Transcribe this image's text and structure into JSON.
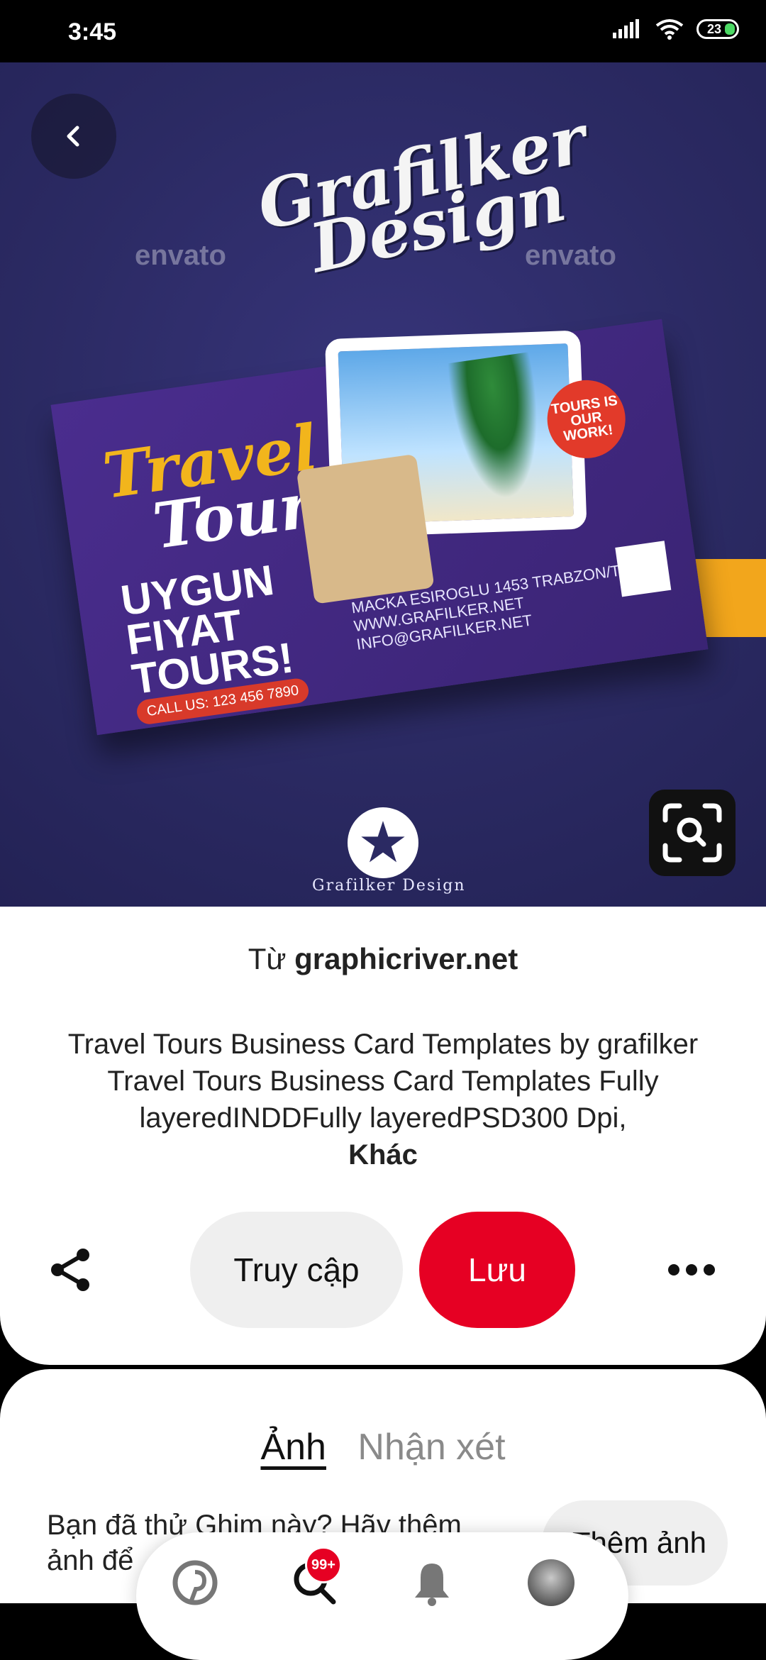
{
  "status_bar": {
    "time": "3:45",
    "battery": "23"
  },
  "hero": {
    "brand_line1": "Grafilker",
    "brand_line2": "Design",
    "watermark": "envato",
    "card_title_line1": "Travel",
    "card_title_line2": "Tours",
    "card_subtitle_line1": "UYGUN",
    "card_subtitle_line2": "FIYAT",
    "card_subtitle_line3": "TOURS!",
    "card_call": "CALL US: 123 456 7890",
    "card_badge": "TOURS IS OUR WORK!",
    "card_address": "MACKA ESIROGLU 1453 TRABZON/TR",
    "card_web": "WWW.GRAFILKER.NET INFO@GRAFILKER.NET",
    "logo_text": "Grafilker Design"
  },
  "panel": {
    "source_prefix": "Từ",
    "source_site": "graphicriver.net",
    "description": "Travel Tours Business Card Templates by grafilker Travel Tours Business Card Templates Fully layeredINDDFully layeredPSD300 Dpi,",
    "more_label": "Khác",
    "visit_label": "Truy cập",
    "save_label": "Lưu"
  },
  "sheet": {
    "tab_photos": "Ảnh",
    "tab_comments": "Nhận xét",
    "tried_prompt": "Bạn đã thử Ghim này? Hãy thêm ảnh để",
    "add_photo_label": "Thêm ảnh"
  },
  "nav": {
    "notification_count": "99+"
  },
  "colors": {
    "accent": "#e60023",
    "hero_bg": "#2b2a63",
    "yellow": "#f2a61c"
  }
}
